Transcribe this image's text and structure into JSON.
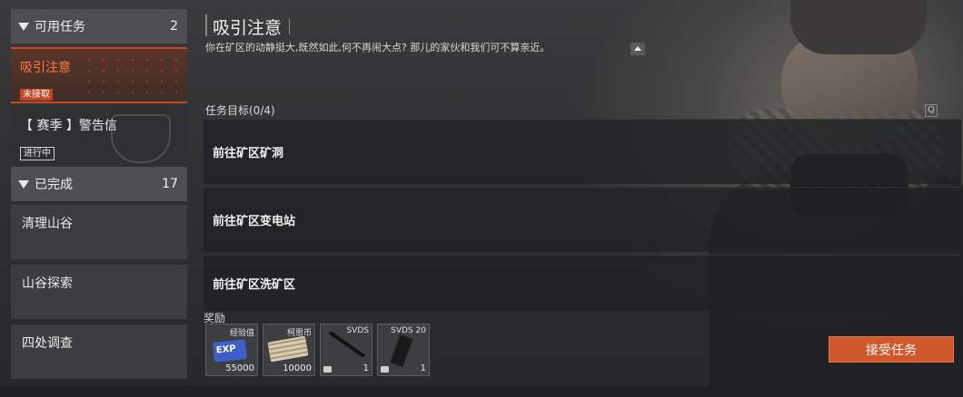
{
  "sidebar": {
    "available": {
      "label": "可用任务",
      "count": "2"
    },
    "tasks": [
      {
        "name": "吸引注意",
        "badge": "未接取"
      },
      {
        "name": "【 赛季 】警告信",
        "badge": "进行中"
      }
    ],
    "completed": {
      "label": "已完成",
      "count": "17"
    },
    "completed_tasks": [
      "清理山谷",
      "山谷探索",
      "四处调查"
    ]
  },
  "main": {
    "title": "吸引注意",
    "description": "你在矿区的动静挺大,既然如此,何不再闹大点? 那儿的家伙和我们可不算亲近。",
    "objectives_header": "任务目标(0/4)",
    "hint_key": "Q",
    "objectives": [
      "前往矿区矿洞",
      "前往矿区变电站",
      "前往矿区洗矿区"
    ]
  },
  "rewards": {
    "label": "奖励",
    "items": [
      {
        "name": "经验值",
        "count": "55000",
        "icon": "exp-icon",
        "icon_text": "EXP"
      },
      {
        "name": "柯恩币",
        "count": "10000",
        "icon": "cash-icon"
      },
      {
        "name": "SVDS",
        "count": "1",
        "icon": "rifle-icon"
      },
      {
        "name": "SVDS 20",
        "count": "1",
        "icon": "magazine-icon"
      }
    ]
  },
  "accept_button": "接受任务",
  "colors": {
    "accent": "#d0582a",
    "selected_text": "#ff7a3c"
  }
}
